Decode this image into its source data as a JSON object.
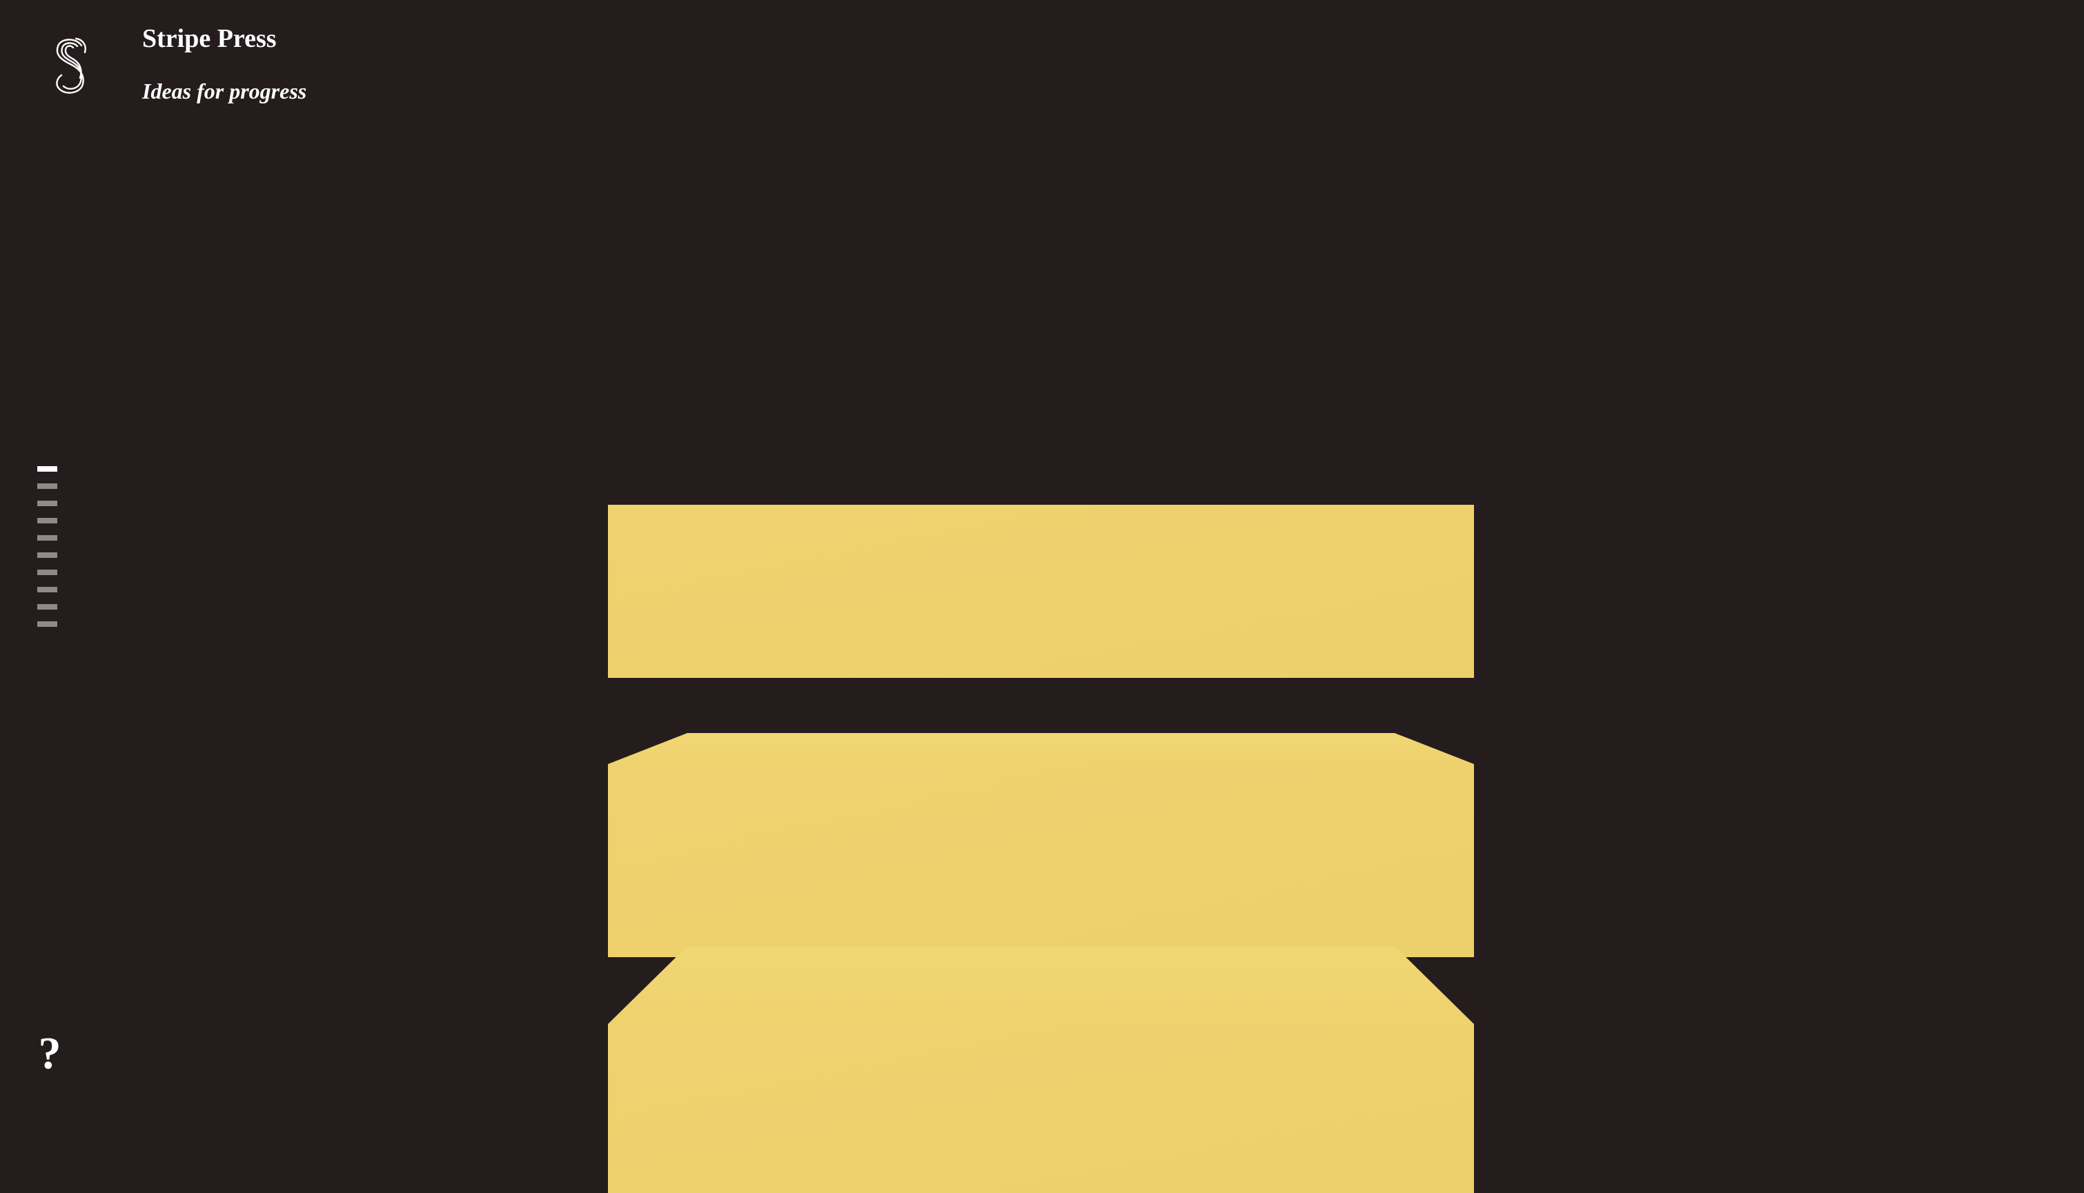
{
  "brand": {
    "logo_icon": "stripe-press-s-logo-icon",
    "title": "Stripe Press",
    "tagline": "Ideas for progress"
  },
  "section_nav": {
    "item_count": 10,
    "active_index": 0
  },
  "help": {
    "label": "?"
  },
  "colors": {
    "background": "#251d1d",
    "accent_yellow": "#efd26e",
    "nav_inactive": "#8f8a8a",
    "nav_active": "#ffffff"
  }
}
